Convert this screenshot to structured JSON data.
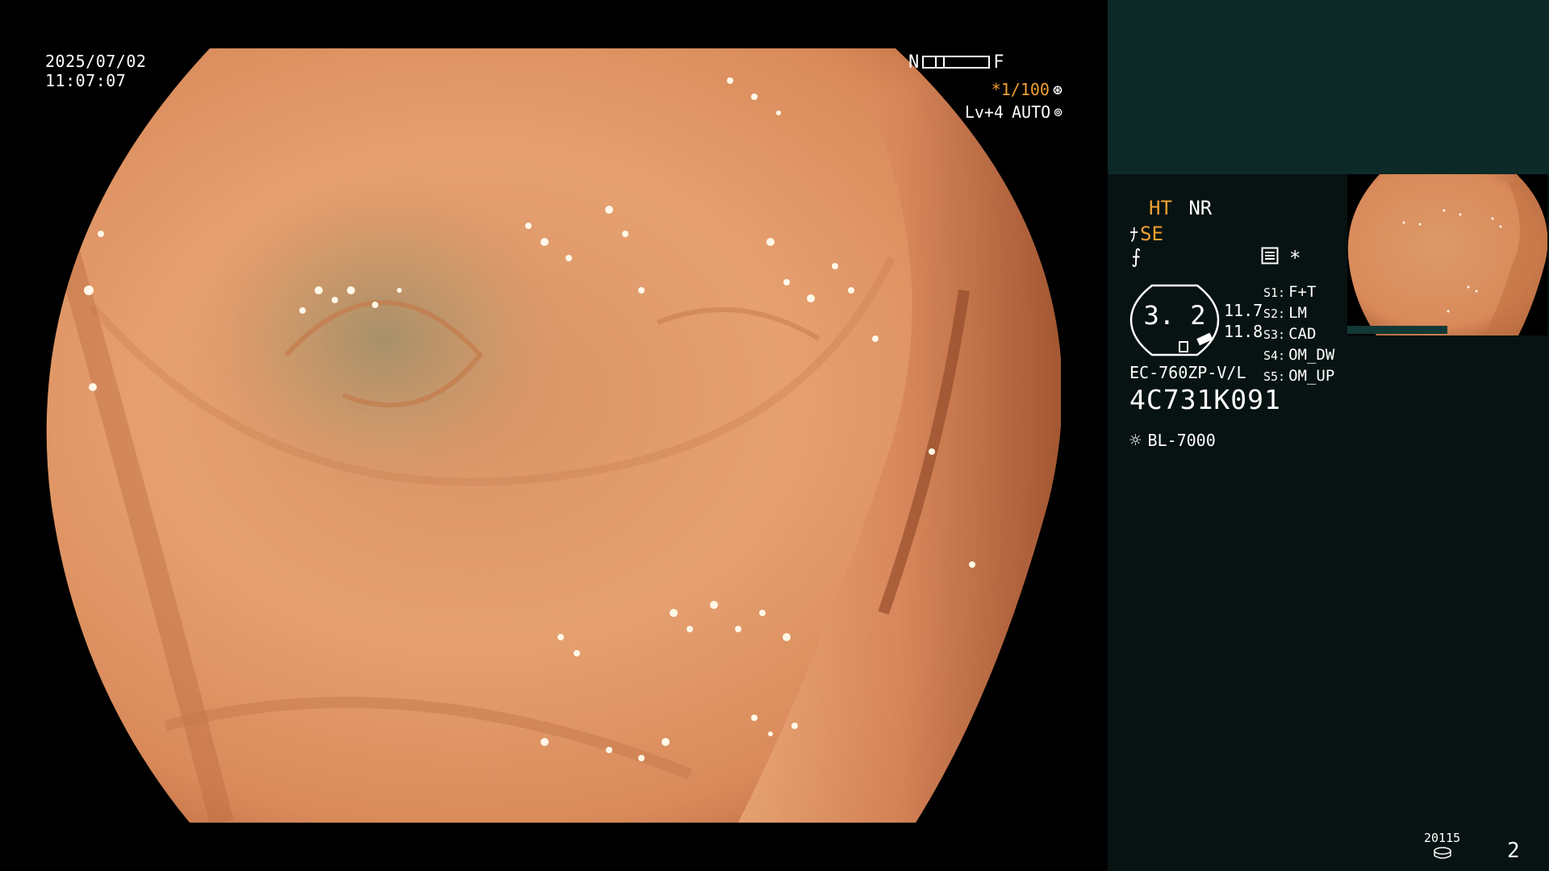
{
  "image_overlay": {
    "date": "2025/07/02",
    "time": "11:07:07",
    "near_label": "N",
    "far_label": "F",
    "shutter": "*1/100",
    "shutter_icon": "aperture-icon",
    "level": "Lv+4",
    "exposure_mode": "AUTO",
    "exposure_icon": "iris-icon"
  },
  "panel": {
    "ht": "HT",
    "nr": "NR",
    "se": "SE",
    "f_glyph": "⨍",
    "star": "*",
    "badge_value": "3. 2",
    "value_1": "11.7",
    "value_2": "11.8",
    "model": "EC-760ZP-V/L",
    "serial": "4C731K091",
    "light_source": "BL-7000",
    "s_keys": [
      {
        "key": "S1:",
        "value": "F+T"
      },
      {
        "key": "S2:",
        "value": "LM"
      },
      {
        "key": "S3:",
        "value": "CAD"
      },
      {
        "key": "S4:",
        "value": "OM_DW"
      },
      {
        "key": "S5:",
        "value": "OM_UP"
      }
    ],
    "footer_count": "20115",
    "page_number": "2"
  },
  "colors": {
    "panel_bg": "#071312",
    "panel_top_bg": "#0d2a29",
    "accent_orange": "#f0a030"
  }
}
